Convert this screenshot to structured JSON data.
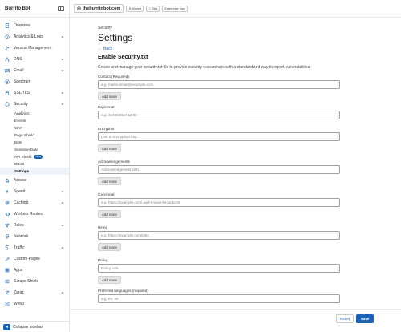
{
  "sidebar": {
    "title": "Burrito Bot",
    "items": [
      {
        "label": "Overview",
        "icon": "document-icon"
      },
      {
        "label": "Analytics & Logs",
        "icon": "clock-icon",
        "has_chevron": true
      },
      {
        "label": "Version Management",
        "icon": "branch-icon"
      },
      {
        "label": "DNS",
        "icon": "network-icon",
        "has_chevron": true
      },
      {
        "label": "Email",
        "icon": "envelope-icon",
        "has_chevron": true
      },
      {
        "label": "Spectrum",
        "icon": "spectrum-icon"
      },
      {
        "label": "SSL/TLS",
        "icon": "lock-icon",
        "has_chevron": true
      },
      {
        "label": "Security",
        "icon": "shield-icon",
        "has_chevron": true,
        "expanded": true
      }
    ],
    "security_subitems": [
      {
        "label": "Analytics"
      },
      {
        "label": "Events"
      },
      {
        "label": "WAF"
      },
      {
        "label": "Page Shield"
      },
      {
        "label": "Bots"
      },
      {
        "label": "Sensitive Data"
      },
      {
        "label": "API Shield",
        "badge": "New"
      },
      {
        "label": "DDoS"
      },
      {
        "label": "Settings",
        "active": true
      }
    ],
    "items_after": [
      {
        "label": "Access",
        "icon": "access-icon"
      },
      {
        "label": "Speed",
        "icon": "bolt-icon",
        "has_chevron": true
      },
      {
        "label": "Caching",
        "icon": "stack-icon",
        "has_chevron": true
      },
      {
        "label": "Workers Routes",
        "icon": "workers-icon"
      },
      {
        "label": "Rules",
        "icon": "funnel-icon",
        "has_chevron": true
      },
      {
        "label": "Network",
        "icon": "pin-icon"
      },
      {
        "label": "Traffic",
        "icon": "route-icon",
        "has_chevron": true
      },
      {
        "label": "Custom Pages",
        "icon": "wrench-icon"
      },
      {
        "label": "Apps",
        "icon": "apps-icon"
      },
      {
        "label": "Scrape Shield",
        "icon": "scrape-shield-icon"
      },
      {
        "label": "Zaraz",
        "icon": "zaraz-icon",
        "has_chevron": true
      },
      {
        "label": "Web3",
        "icon": "web3-icon"
      }
    ],
    "collapse_label": "Collapse sidebar"
  },
  "topbar": {
    "domain": "theburritobot.com",
    "chips": [
      {
        "label": "Moved",
        "icon": "x-icon"
      },
      {
        "label": "Star",
        "icon": "star-icon"
      },
      {
        "label": "Enterprise plan",
        "icon": ""
      }
    ]
  },
  "page": {
    "breadcrumb": "Security",
    "title": "Settings",
    "back": "Back",
    "section_title": "Enable Security.txt",
    "section_desc": "Create and manage your security.txt file to provide security researchers with a standardized way to report vulnerabilities"
  },
  "fields": [
    {
      "label": "Contact (Required)",
      "placeholder": "e.g. mailto:email@example.com",
      "add_more": "Add more"
    },
    {
      "label": "Expires at",
      "placeholder": "e.g. 31/08/2024 12:00",
      "add_more": ""
    },
    {
      "label": "Encryption",
      "placeholder": "Link to encryption key...",
      "add_more": "Add more"
    },
    {
      "label": "Acknowledgements",
      "placeholder": "Acknowledgement URL",
      "add_more": "Add more"
    },
    {
      "label": "Canonical",
      "placeholder": "e.g. https://example.com/.well-known/security.txt",
      "add_more": "Add more"
    },
    {
      "label": "Hiring",
      "placeholder": "e.g. https://example.com/jobs",
      "add_more": "Add more"
    },
    {
      "label": "Policy",
      "placeholder": "Policy URL",
      "add_more": "Add more"
    },
    {
      "label": "Preferred languages (required)",
      "placeholder": "e.g. en, es",
      "add_more": ""
    }
  ],
  "actions": {
    "reset": "Reset",
    "save": "Save"
  },
  "colors": {
    "accent": "#1a63b8",
    "border": "#9aa0a6"
  }
}
